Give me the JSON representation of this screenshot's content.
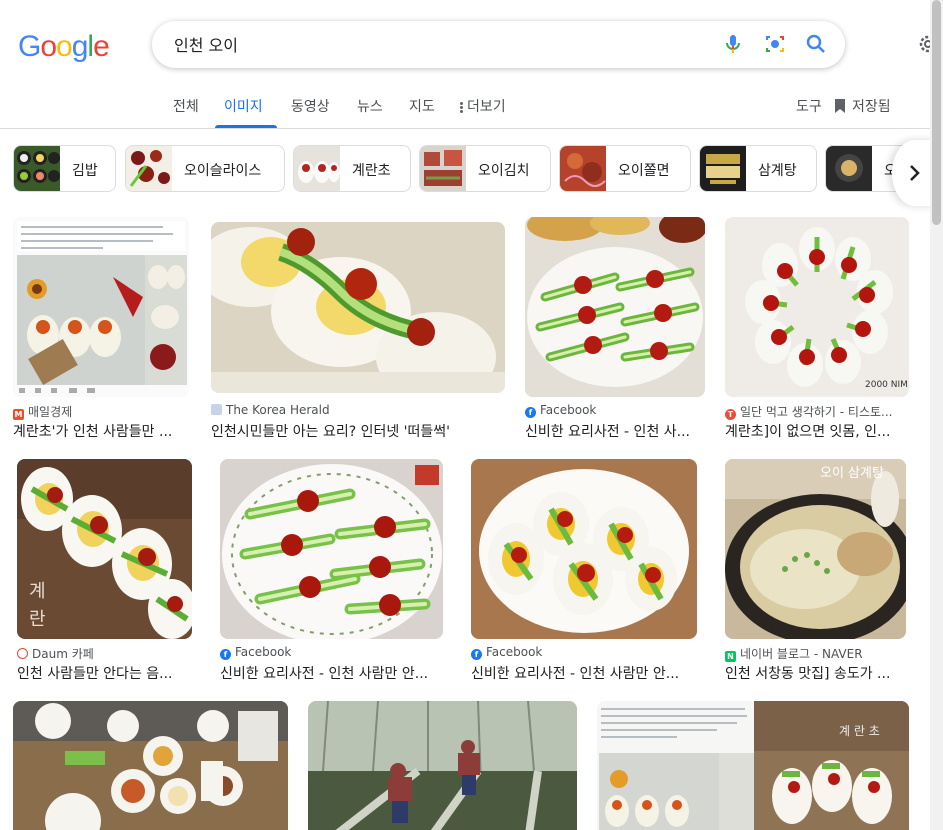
{
  "search": {
    "query": "인천 오이"
  },
  "tabs": [
    {
      "label": "전체"
    },
    {
      "label": "이미지"
    },
    {
      "label": "동영상"
    },
    {
      "label": "뉴스"
    },
    {
      "label": "지도"
    },
    {
      "label": "더보기"
    }
  ],
  "tools": {
    "tools_label": "도구",
    "saved_label": "저장됨"
  },
  "chips": [
    {
      "label": "김밥"
    },
    {
      "label": "오이슬라이스"
    },
    {
      "label": "계란초"
    },
    {
      "label": "오이김치"
    },
    {
      "label": "오이쫄면"
    },
    {
      "label": "삼계탕"
    },
    {
      "label": "오"
    }
  ],
  "results": [
    {
      "source": "매일경제",
      "title": "계란초'가 인천 사람들만 ...",
      "icon_color": "#e8512d"
    },
    {
      "source": "The Korea Herald",
      "title": "인천시민들만 아는 요리? 인터넷 '떠들썩'",
      "icon_color": "#c7d3e6"
    },
    {
      "source": "Facebook",
      "title": "신비한 요리사전 - 인천 사...",
      "icon_color": "#1877f2"
    },
    {
      "source": "일단 먹고 생각하기 - 티스토...",
      "title": "계란초]이 없으면 잇몸, 인...",
      "icon_color": "#eb4b3a"
    },
    {
      "source": "Daum 카페",
      "title": "인천 사람들만 안다는 음...",
      "icon_color": "#e44a3b"
    },
    {
      "source": "Facebook",
      "title": "신비한 요리사전 - 인천 사람만 안...",
      "icon_color": "#1877f2"
    },
    {
      "source": "Facebook",
      "title": "신비한 요리사전 - 인천 사람만 안...",
      "icon_color": "#1877f2"
    },
    {
      "source": "네이버 블로그 - NAVER",
      "title": "인천 서창동 맛집] 송도가 ...",
      "icon_color": "#03c75a"
    }
  ],
  "image_texts": {
    "soup_caption": "오이 삼계탕",
    "egg_caption": "계\n란",
    "egg_caption2": "계 란 초",
    "watermark": "2000 NIM"
  }
}
